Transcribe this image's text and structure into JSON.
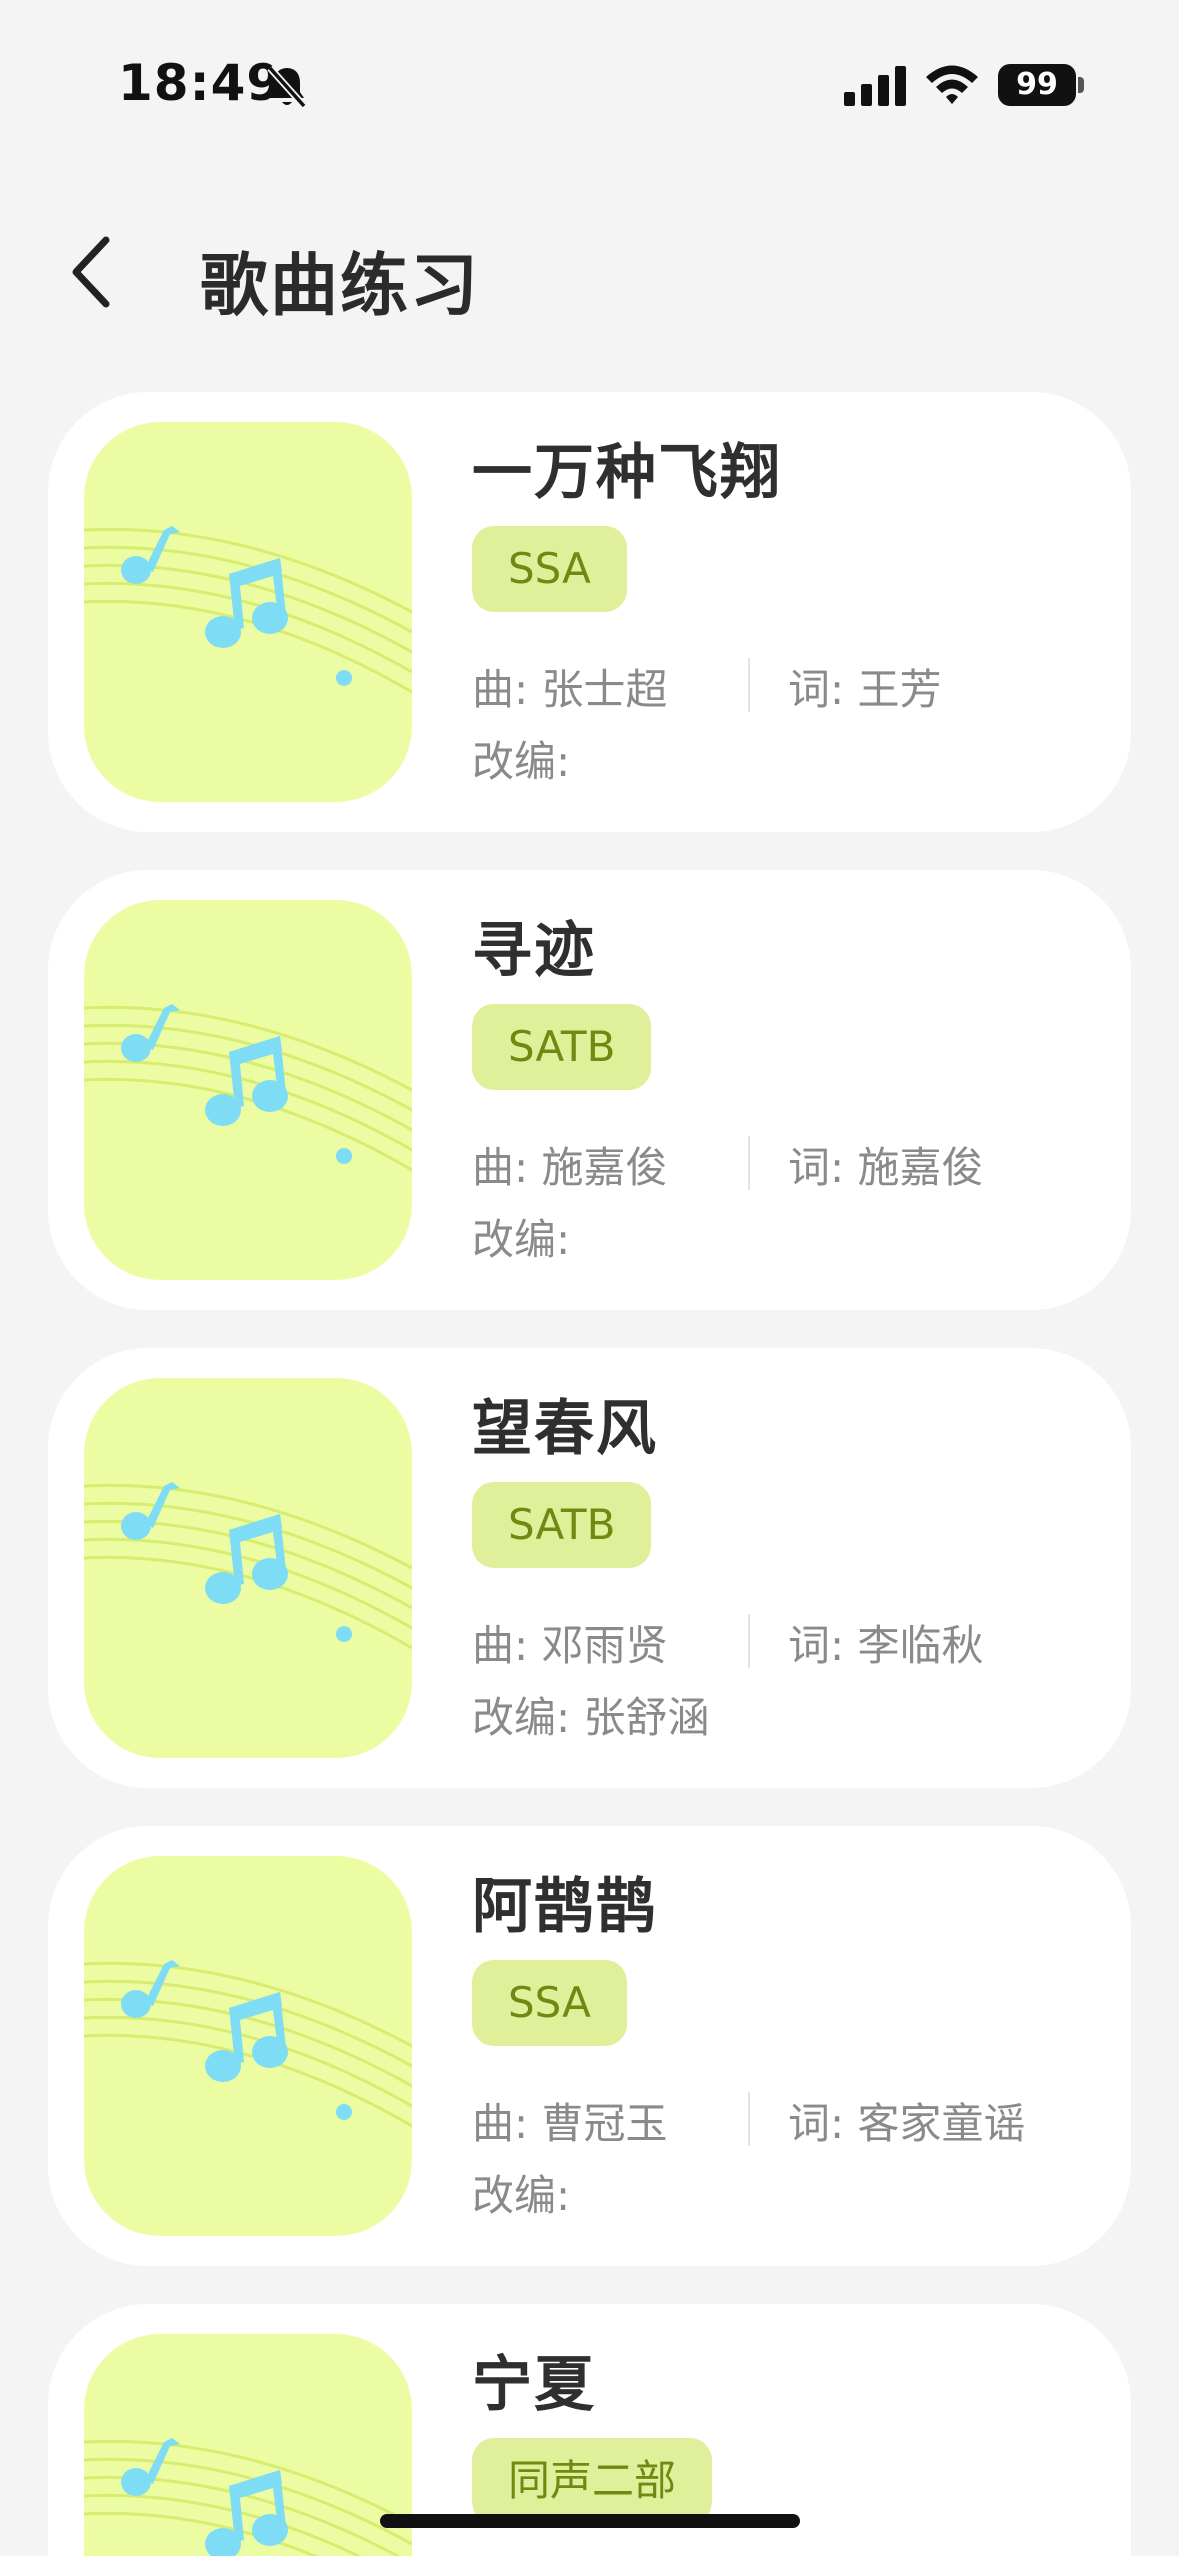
{
  "status_bar": {
    "time": "18:49",
    "battery": "99"
  },
  "header": {
    "title": "歌曲练习"
  },
  "songs": [
    {
      "title": "一万种飞翔",
      "voicing": "SSA",
      "music": "曲: 张士超",
      "lyrics": "词: 王芳",
      "arranger": "改编: "
    },
    {
      "title": "寻迹",
      "voicing": "SATB",
      "music": "曲: 施嘉俊",
      "lyrics": "词: 施嘉俊",
      "arranger": "改编: "
    },
    {
      "title": "望春风",
      "voicing": "SATB",
      "music": "曲: 邓雨贤",
      "lyrics": "词: 李临秋",
      "arranger": "改编: 张舒涵"
    },
    {
      "title": "阿鹊鹊",
      "voicing": "SSA",
      "music": "曲: 曹冠玉",
      "lyrics": "词: 客家童谣",
      "arranger": "改编: "
    },
    {
      "title": "宁夏",
      "voicing": "同声二部",
      "music": "",
      "lyrics": "",
      "arranger": ""
    }
  ],
  "theme": {
    "thumb_background": "#ecfca3",
    "note_color": "#7fdcf5",
    "badge_background": "#e0f09a",
    "badge_text": "#6e8a12"
  },
  "icons": {
    "back": "chevron-left-icon",
    "thumbnail": "music-note-icon",
    "bell": "bell-slash-icon",
    "signal": "signal-icon",
    "wifi": "wifi-icon",
    "battery": "battery-icon"
  }
}
